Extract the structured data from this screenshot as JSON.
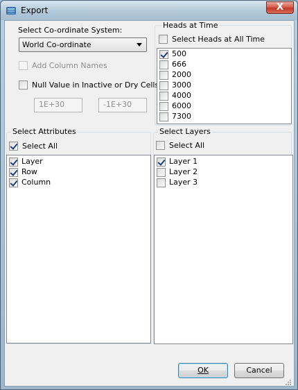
{
  "window": {
    "title": "Export",
    "close_label": "X"
  },
  "coordinate_system": {
    "label": "Select Co-ordinate System:",
    "selected": "World Co-ordinate"
  },
  "add_column_names": {
    "label": "Add Column Names",
    "checked": false,
    "enabled": false
  },
  "null_value": {
    "label": "Null Value in Inactive or Dry Cells:",
    "checked": false,
    "min_value": "1E+30",
    "max_value": "-1E+30"
  },
  "heads_at_time": {
    "title": "Heads at Time",
    "select_all_label": "Select Heads at All Time",
    "select_all_checked": false,
    "items": [
      {
        "label": "500",
        "checked": true
      },
      {
        "label": "666",
        "checked": false
      },
      {
        "label": "2000",
        "checked": false
      },
      {
        "label": "3000",
        "checked": false
      },
      {
        "label": "4000",
        "checked": false
      },
      {
        "label": "6000",
        "checked": false
      },
      {
        "label": "7300",
        "checked": false
      }
    ]
  },
  "attributes": {
    "title": "Select Attributes",
    "select_all_label": "Select All",
    "select_all_checked": true,
    "items": [
      {
        "label": "Layer",
        "checked": true
      },
      {
        "label": "Row",
        "checked": true
      },
      {
        "label": "Column",
        "checked": true
      }
    ]
  },
  "layers": {
    "title": "Select Layers",
    "select_all_label": "Select All",
    "select_all_checked": false,
    "items": [
      {
        "label": "Layer 1",
        "checked": true
      },
      {
        "label": "Layer 2",
        "checked": false
      },
      {
        "label": "Layer 3",
        "checked": false
      }
    ]
  },
  "buttons": {
    "ok": "OK",
    "cancel": "Cancel"
  }
}
